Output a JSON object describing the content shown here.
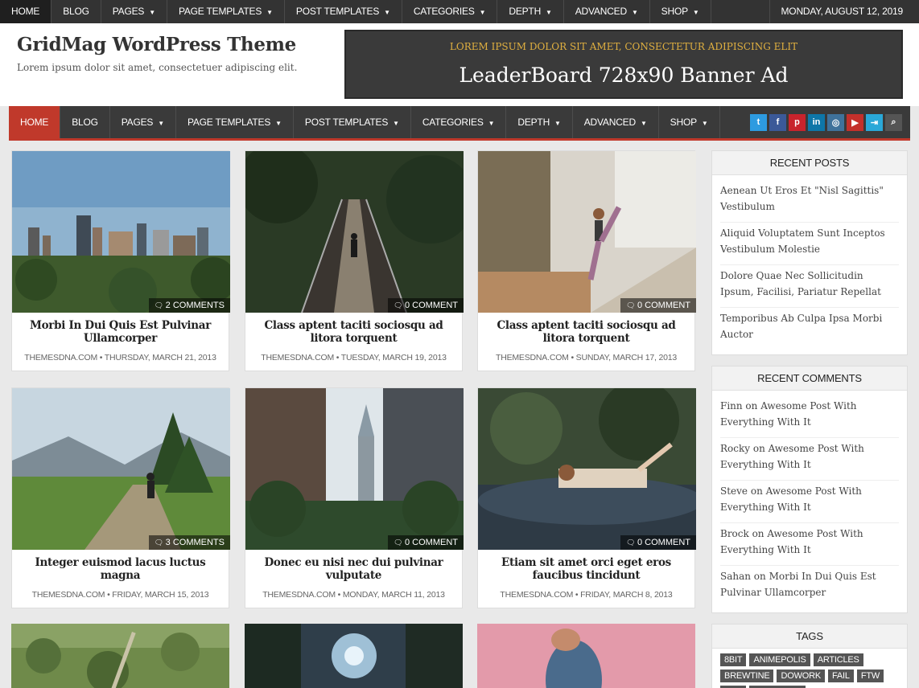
{
  "topbar": {
    "items": [
      {
        "label": "HOME",
        "caret": false
      },
      {
        "label": "BLOG",
        "caret": false
      },
      {
        "label": "PAGES",
        "caret": true
      },
      {
        "label": "PAGE TEMPLATES",
        "caret": true
      },
      {
        "label": "POST TEMPLATES",
        "caret": true
      },
      {
        "label": "CATEGORIES",
        "caret": true
      },
      {
        "label": "DEPTH",
        "caret": true
      },
      {
        "label": "ADVANCED",
        "caret": true
      },
      {
        "label": "SHOP",
        "caret": true
      }
    ],
    "date": "MONDAY, AUGUST 12, 2019"
  },
  "header": {
    "title": "GridMag WordPress Theme",
    "description": "Lorem ipsum dolor sit amet, consectetuer adipiscing elit.",
    "banner_line1": "LOREM IPSUM DOLOR SIT AMET, CONSECTETUR ADIPISCING ELIT",
    "banner_line2": "LeaderBoard 728x90 Banner Ad"
  },
  "mainnav": {
    "items": [
      {
        "label": "HOME",
        "caret": false
      },
      {
        "label": "BLOG",
        "caret": false
      },
      {
        "label": "PAGES",
        "caret": true
      },
      {
        "label": "PAGE TEMPLATES",
        "caret": true
      },
      {
        "label": "POST TEMPLATES",
        "caret": true
      },
      {
        "label": "CATEGORIES",
        "caret": true
      },
      {
        "label": "DEPTH",
        "caret": true
      },
      {
        "label": "ADVANCED",
        "caret": true
      },
      {
        "label": "SHOP",
        "caret": true
      }
    ],
    "social": [
      {
        "icon": "twitter-icon",
        "glyph": "t",
        "color": "#2d9be0"
      },
      {
        "icon": "facebook-icon",
        "glyph": "f",
        "color": "#3b5998"
      },
      {
        "icon": "pinterest-icon",
        "glyph": "p",
        "color": "#c8232c"
      },
      {
        "icon": "linkedin-icon",
        "glyph": "in",
        "color": "#0e76a8"
      },
      {
        "icon": "instagram-icon",
        "glyph": "◎",
        "color": "#3f729b"
      },
      {
        "icon": "youtube-icon",
        "glyph": "▶",
        "color": "#c4302b"
      },
      {
        "icon": "login-icon",
        "glyph": "⇥",
        "color": "#2aa8d8"
      },
      {
        "icon": "search-icon",
        "glyph": "⌕",
        "color": "#555555"
      }
    ]
  },
  "posts": [
    {
      "comments": "2 COMMENTS",
      "title": "Morbi In Dui Quis Est Pulvinar Ullamcorper",
      "author": "THEMESDNA.COM",
      "date": "THURSDAY, MARCH 21, 2013"
    },
    {
      "comments": "0 COMMENT",
      "title": "Class aptent taciti sociosqu ad litora torquent",
      "author": "THEMESDNA.COM",
      "date": "TUESDAY, MARCH 19, 2013"
    },
    {
      "comments": "0 COMMENT",
      "title": "Class aptent taciti sociosqu ad litora torquent",
      "author": "THEMESDNA.COM",
      "date": "SUNDAY, MARCH 17, 2013"
    },
    {
      "comments": "3 COMMENTS",
      "title": "Integer euismod lacus luctus magna",
      "author": "THEMESDNA.COM",
      "date": "FRIDAY, MARCH 15, 2013"
    },
    {
      "comments": "0 COMMENT",
      "title": "Donec eu nisi nec dui pulvinar vulputate",
      "author": "THEMESDNA.COM",
      "date": "MONDAY, MARCH 11, 2013"
    },
    {
      "comments": "0 COMMENT",
      "title": "Etiam sit amet orci eget eros faucibus tincidunt",
      "author": "THEMESDNA.COM",
      "date": "FRIDAY, MARCH 8, 2013"
    }
  ],
  "sidebar": {
    "recent_posts_title": "RECENT POSTS",
    "recent_posts": [
      "Aenean Ut Eros Et \"Nisl Sagittis\" Vestibulum",
      "Aliquid Voluptatem Sunt Inceptos Vestibulum Molestie",
      "Dolore Quae Nec Sollicitudin Ipsum, Facilisi, Pariatur Repellat",
      "Temporibus Ab Culpa Ipsa Morbi Auctor"
    ],
    "recent_comments_title": "RECENT COMMENTS",
    "recent_comments": [
      "Finn on Awesome Post With Everything With It",
      "Rocky on Awesome Post With Everything With It",
      "Steve on Awesome Post With Everything With It",
      "Brock on Awesome Post With Everything With It",
      "Sahan on Morbi In Dui Quis Est Pulvinar Ullamcorper"
    ],
    "tags_title": "TAGS",
    "tags": [
      "8BIT",
      "ANIMEPOLIS",
      "ARTICLES",
      "BREWTINE",
      "DOWORK",
      "FAIL",
      "FTW",
      "FUN",
      "HOOPPLER"
    ]
  },
  "colors": {
    "accent": "#c0392b",
    "nav_bg": "#3a3a3a",
    "topbar_bg": "#333333",
    "banner_text": "#e0b040"
  }
}
